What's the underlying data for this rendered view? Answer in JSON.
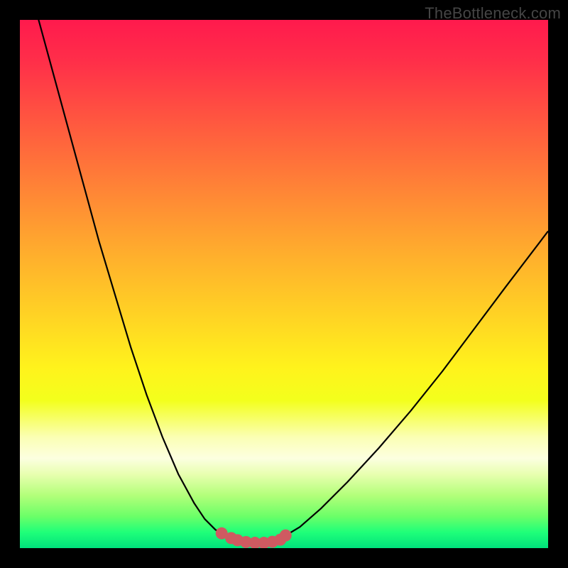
{
  "watermark": "TheBottleneck.com",
  "colors": {
    "frame": "#000000",
    "curve": "#000000",
    "marker": "#cf5a61",
    "marker_stroke": "#cf5a61"
  },
  "chart_data": {
    "type": "line",
    "title": "",
    "xlabel": "",
    "ylabel": "",
    "xlim": [
      0,
      100
    ],
    "ylim": [
      0,
      100
    ],
    "series": [
      {
        "name": "bottleneck-curve",
        "x": [
          0,
          3,
          6,
          9,
          12,
          15,
          18,
          21,
          24,
          27,
          30,
          33,
          35,
          37,
          38.5,
          40,
          42,
          44,
          46,
          48,
          50,
          53,
          57,
          62,
          68,
          74,
          80,
          86,
          92,
          100
        ],
        "y": [
          112,
          102,
          91,
          80,
          69,
          58,
          48,
          38,
          29,
          21,
          14,
          8.5,
          5.5,
          3.5,
          2.5,
          1.8,
          1.2,
          1.0,
          1.0,
          1.3,
          2.2,
          4.0,
          7.5,
          12.5,
          19,
          26,
          33.5,
          41.5,
          49.5,
          60
        ]
      }
    ],
    "markers": {
      "name": "flat-region-dots",
      "x": [
        38.2,
        40.0,
        41.2,
        42.8,
        44.5,
        46.2,
        47.8,
        49.3,
        50.3
      ],
      "y": [
        2.8,
        1.9,
        1.5,
        1.15,
        1.0,
        1.0,
        1.2,
        1.6,
        2.4
      ]
    }
  }
}
